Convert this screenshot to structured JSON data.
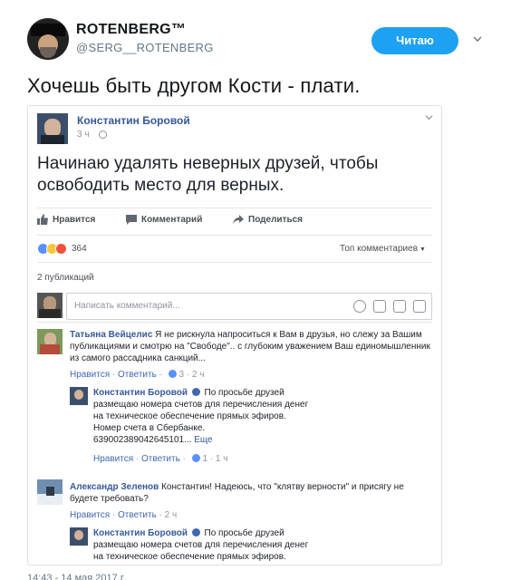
{
  "tweet": {
    "author_name": "ROTENBERG™",
    "handle": "@SERG__ROTENBERG",
    "follow_label": "Читаю",
    "text": "Хочешь быть другом Кости - плати.",
    "timestamp": "14:43 - 14 мая 2017 г."
  },
  "fb_post": {
    "author": "Константин Боровой",
    "time": "3 ч",
    "text": "Начинаю удалять неверных друзей, чтобы освободить место для верных.",
    "actions": {
      "like": "Нравится",
      "comment": "Комментарий",
      "share": "Поделиться"
    },
    "reaction_count": "364",
    "top_comments": "Топ комментариев",
    "shares": "2 публикаций",
    "composer_placeholder": "Написать комментарий..."
  },
  "comments": [
    {
      "author": "Татьяна Вейцелис",
      "text": "Я не рискнула напроситься к Вам в друзья, но слежу за Вашим публикациями и смотрю на \"Свободе\".. с глубоким уважением Ваш единомышленник из самого рассадника санкций...",
      "like": "Нравится",
      "reply": "Ответить",
      "reactions": "3",
      "time": "2 ч"
    },
    {
      "author": "Константин Боровой",
      "text": "По просьбе друзей размещаю номера счетов для перечисления денег на техническое обеспечение прямых эфиров.",
      "text2": "Номер счета в Сбербанке.",
      "text3": "639002389042645101...",
      "more": "Еще",
      "like": "Нравится",
      "reply": "Ответить",
      "reactions": "1",
      "time": "1 ч"
    },
    {
      "author": "Александр Зеленов",
      "text": "Константин! Надеюсь, что \"клятву верности\" и присягу не будете требовать?",
      "like": "Нравится",
      "reply": "Ответить",
      "time": "2 ч"
    },
    {
      "author": "Константин Боровой",
      "text": "По просьбе друзей размещаю номера счетов для перечисления денег на техническое обеспечение прямых эфиров."
    }
  ],
  "colors": {
    "twitter_blue": "#1da1f2",
    "fb_link": "#365899"
  }
}
